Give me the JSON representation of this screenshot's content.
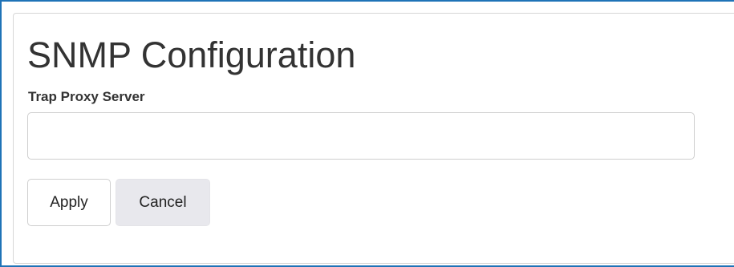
{
  "page": {
    "title": "SNMP Configuration"
  },
  "form": {
    "trap_proxy_label": "Trap Proxy Server",
    "trap_proxy_value": "",
    "trap_proxy_placeholder": ""
  },
  "actions": {
    "apply_label": "Apply",
    "cancel_label": "Cancel"
  },
  "colors": {
    "frame_border": "#1f73b7",
    "panel_border": "#d7d7d7",
    "cancel_background": "#e8e8ed",
    "text": "#333333"
  }
}
